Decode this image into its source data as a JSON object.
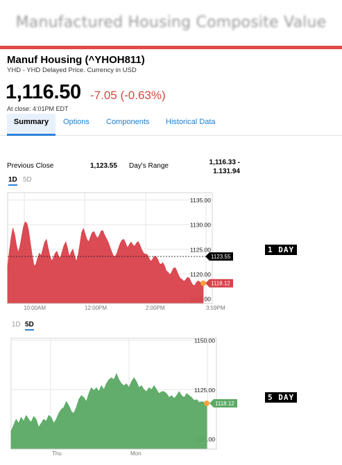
{
  "banner": {
    "title": "Manufactured Housing Composite Value"
  },
  "quote": {
    "name": "Manuf Housing (^YHOH811)",
    "subtitle": "YHD - YHD Delayed Price. Currency in USD",
    "price": "1,116.50",
    "change": "-7.05 (-0.63%)",
    "close_time": "At close: 4:01PM EDT"
  },
  "tabs": [
    {
      "label": "Summary",
      "active": true
    },
    {
      "label": "Options",
      "active": false
    },
    {
      "label": "Components",
      "active": false
    },
    {
      "label": "Historical Data",
      "active": false
    }
  ],
  "stats": {
    "prev_close_label": "Previous Close",
    "prev_close_value": "1,123.55",
    "days_range_label": "Day's Range",
    "days_range_value": "1,116.33 - 1.131.94"
  },
  "chart1_tabs": {
    "one_day": "1D",
    "five_day": "5D",
    "active": "1D"
  },
  "chart2_tabs": {
    "one_day": "1D",
    "five_day": "5D",
    "active": "5D"
  },
  "side_labels": {
    "day": "1 DAY",
    "five_day": "5 DAY"
  },
  "colors": {
    "down_fill": "#d9414a",
    "up_fill": "#5aa964",
    "marker": "#f5a03a",
    "accent": "#2b82d8"
  },
  "chart_data": [
    {
      "type": "area",
      "x_ticks": [
        "10:00AM",
        "12:00PM",
        "2:00PM",
        "3:59PM"
      ],
      "y_ticks": [
        "1135.00",
        "1130.00",
        "1125.00",
        "1120.00",
        "1115.00"
      ],
      "ylim": [
        1114,
        1136.5
      ],
      "reference_line": {
        "value": 1123.55,
        "label": "1123.55"
      },
      "last": {
        "value": 1118.12,
        "label": "1118.12"
      },
      "values": [
        1121.6,
        1124.6,
        1127.4,
        1129.3,
        1128.0,
        1125.8,
        1124.3,
        1125.6,
        1127.6,
        1129.6,
        1130.6,
        1130.2,
        1128.6,
        1126.0,
        1123.6,
        1121.6,
        1121.9,
        1123.2,
        1124.2,
        1123.7,
        1125.0,
        1126.4,
        1127.0,
        1125.2,
        1123.6,
        1122.6,
        1123.3,
        1124.2,
        1124.6,
        1123.5,
        1123.3,
        1124.6,
        1125.8,
        1126.5,
        1125.2,
        1123.5,
        1124.4,
        1125.0,
        1123.7,
        1122.5,
        1123.8,
        1126.0,
        1128.4,
        1129.2,
        1128.1,
        1127.0,
        1126.5,
        1127.5,
        1128.4,
        1128.6,
        1127.8,
        1127.2,
        1127.8,
        1128.7,
        1128.8,
        1127.9,
        1127.2,
        1126.5,
        1125.5,
        1124.5,
        1123.7,
        1123.5,
        1124.2,
        1125.3,
        1126.3,
        1126.9,
        1127.0,
        1126.2,
        1125.3,
        1125.9,
        1126.5,
        1125.9,
        1125.6,
        1126.2,
        1126.6,
        1125.9,
        1125.0,
        1124.3,
        1124.0,
        1124.0,
        1123.4,
        1122.6,
        1122.8,
        1123.5,
        1123.6,
        1123.1,
        1122.2,
        1121.9,
        1122.3,
        1121.7,
        1120.6,
        1120.4,
        1119.8,
        1120.3,
        1121.1,
        1121.3,
        1120.6,
        1119.7,
        1119.1,
        1118.9,
        1118.5,
        1118.8,
        1119.3,
        1119.2,
        1118.4,
        1117.8,
        1117.6,
        1118.2,
        1118.6,
        1118.4,
        1118.1,
        1118.12
      ]
    },
    {
      "type": "area",
      "x_ticks": [
        "Thu",
        "Mon"
      ],
      "y_ticks": [
        "1150.00",
        "1125.00",
        "1100.00"
      ],
      "ylim": [
        1095,
        1151
      ],
      "last": {
        "value": 1118.12,
        "label": "1118.12"
      },
      "values": [
        1104.0,
        1107.0,
        1110.0,
        1108.0,
        1111.0,
        1109.0,
        1112.0,
        1110.0,
        1108.5,
        1111.5,
        1110.0,
        1106.0,
        1108.0,
        1110.0,
        1109.0,
        1112.0,
        1111.0,
        1108.0,
        1110.0,
        1113.0,
        1115.0,
        1116.0,
        1119.0,
        1117.0,
        1114.0,
        1113.0,
        1116.0,
        1120.0,
        1122.0,
        1121.0,
        1119.0,
        1123.0,
        1126.0,
        1124.5,
        1126.0,
        1124.0,
        1127.0,
        1125.0,
        1128.0,
        1130.0,
        1131.0,
        1130.0,
        1133.0,
        1130.0,
        1128.0,
        1127.0,
        1128.0,
        1126.0,
        1129.0,
        1131.0,
        1129.0,
        1126.0,
        1127.0,
        1125.0,
        1124.0,
        1126.0,
        1125.0,
        1127.0,
        1125.0,
        1123.0,
        1124.0,
        1124.0,
        1123.0,
        1121.0,
        1122.0,
        1120.5,
        1122.0,
        1124.0,
        1122.0,
        1121.0,
        1123.0,
        1122.0,
        1121.0,
        1119.5,
        1120.0,
        1118.5,
        1119.0,
        1118.5,
        1118.12
      ]
    }
  ]
}
